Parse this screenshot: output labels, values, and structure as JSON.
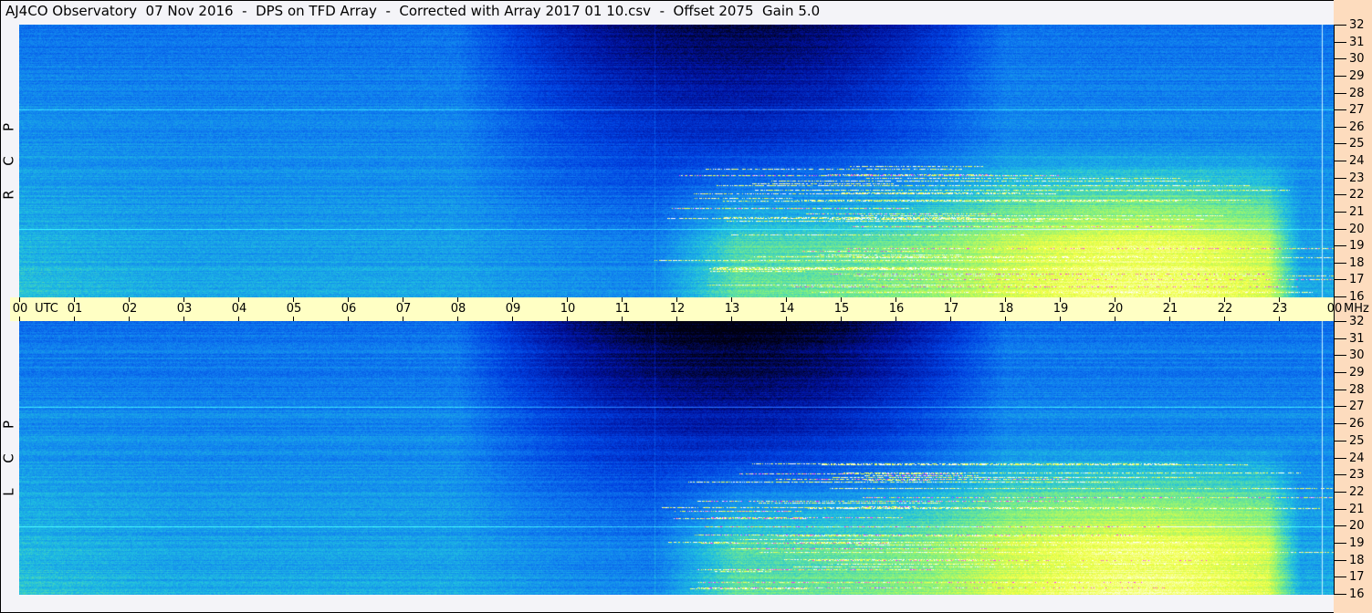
{
  "title": "AJ4CO Observatory  07 Nov 2016  -  DPS on TFD Array  -  Corrected with Array 2017 01 10.csv  -  Offset 2075  Gain 5.0",
  "chart_data": {
    "type": "heatmap",
    "panels": [
      {
        "label": [
          "R",
          "C",
          "P"
        ],
        "name": "RCP"
      },
      {
        "label": [
          "L",
          "C",
          "P"
        ],
        "name": "LCP"
      }
    ],
    "x_unit": "UTC",
    "x_range_hours": [
      0,
      24
    ],
    "x_tick_labels": [
      "00",
      "01",
      "02",
      "03",
      "04",
      "05",
      "06",
      "07",
      "08",
      "09",
      "10",
      "11",
      "12",
      "13",
      "14",
      "15",
      "16",
      "17",
      "18",
      "19",
      "20",
      "21",
      "22",
      "23",
      "00"
    ],
    "y_unit": "MHz",
    "y_range": [
      16,
      32
    ],
    "y_ticks": [
      32,
      31,
      30,
      29,
      28,
      27,
      26,
      25,
      24,
      23,
      22,
      21,
      20,
      19,
      18,
      17,
      16
    ],
    "colormap": [
      "#000010",
      "#00109a",
      "#0040e0",
      "#1080f0",
      "#20c0e0",
      "#80f080",
      "#f0ff40",
      "#ffffff"
    ],
    "interference_color": "#ff30ff",
    "features": {
      "night_depression_hours": [
        9,
        17
      ],
      "day_enhancement_hours": [
        11.6,
        23.4
      ],
      "persistent_lines_mhz": [
        27,
        20
      ]
    }
  }
}
